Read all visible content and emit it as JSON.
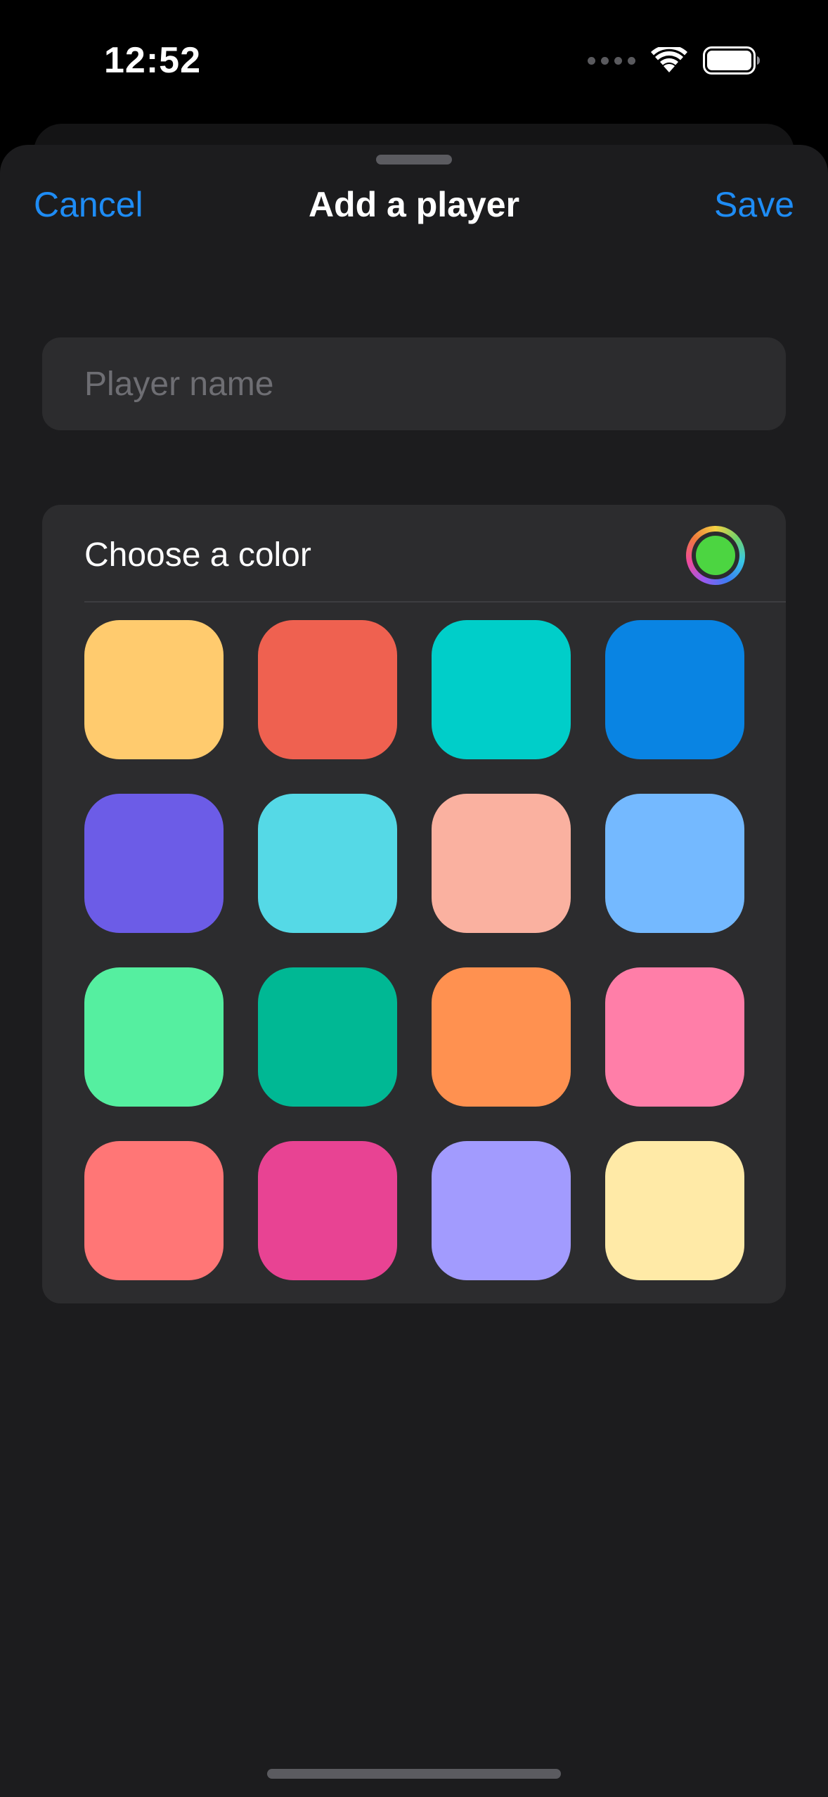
{
  "status_bar": {
    "time": "12:52",
    "icons": [
      "cellular-signal-icon",
      "wifi-icon",
      "battery-icon"
    ]
  },
  "sheet": {
    "title": "Add a player",
    "cancel_label": "Cancel",
    "save_label": "Save",
    "accent_color": "#1e8cf5"
  },
  "name_field": {
    "value": "",
    "placeholder": "Player name"
  },
  "color_section": {
    "label": "Choose a color",
    "selected_color": "#4cd541",
    "swatches": [
      "#ffcb6e",
      "#ef6150",
      "#00cec9",
      "#0984e3",
      "#6c5ce7",
      "#55d9e6",
      "#fab1a0",
      "#74b9ff",
      "#55efa0",
      "#00b894",
      "#ff9150",
      "#ff7ea8",
      "#ff7676",
      "#e84393",
      "#a29bfe",
      "#ffeaa7"
    ]
  }
}
